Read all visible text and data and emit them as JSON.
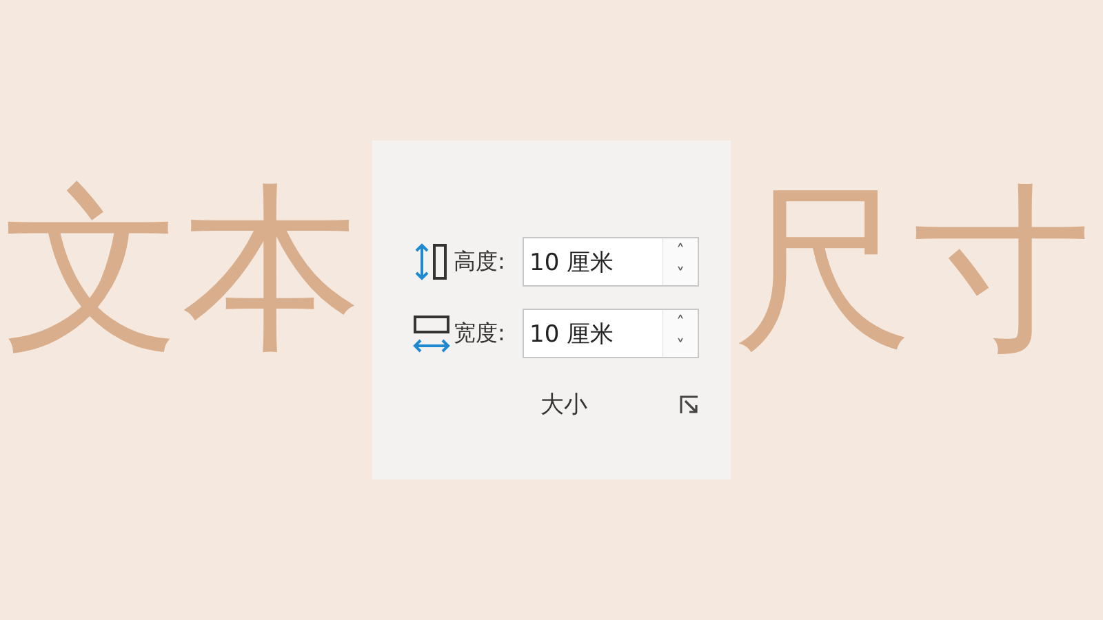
{
  "slide": {
    "words": [
      "文本",
      "尺寸"
    ]
  },
  "size_group": {
    "fields": [
      {
        "kind": "height",
        "label": "高度:",
        "value": "10 厘米",
        "up": "˄",
        "down": "˅"
      },
      {
        "kind": "width",
        "label": "宽度:",
        "value": "10 厘米",
        "up": "˄",
        "down": "˅"
      }
    ],
    "title": "大小"
  }
}
